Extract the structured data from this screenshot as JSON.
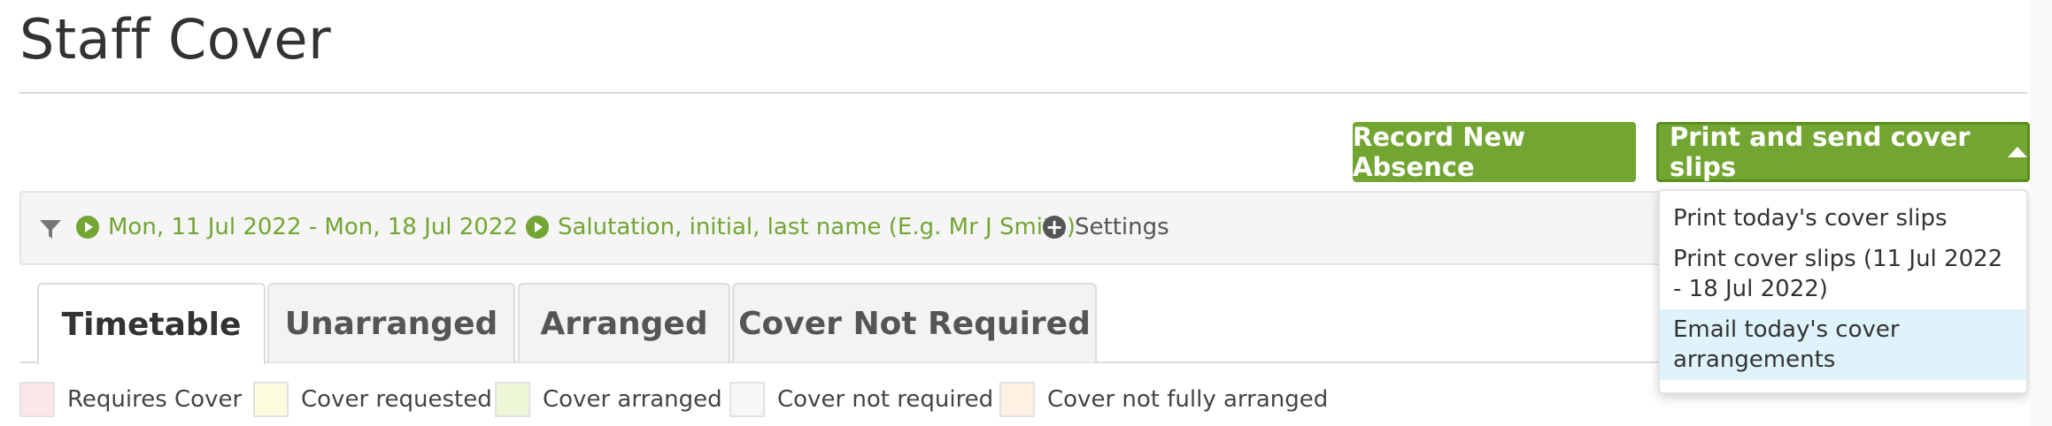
{
  "page": {
    "title": "Staff Cover"
  },
  "actions": {
    "record_label": "Record New Absence",
    "print_label": "Print and send cover slips",
    "accent_color": "#73a532"
  },
  "print_menu": {
    "items": [
      {
        "label": "Print today's cover slips"
      },
      {
        "label": "Print cover slips (11 Jul 2022 - 18 Jul 2022)"
      },
      {
        "label": "Email today's cover arrangements",
        "highlighted": true
      }
    ]
  },
  "filters": {
    "icon": "filter-icon",
    "date_range": "Mon, 11 Jul 2022 - Mon, 18 Jul 2022",
    "name_format": "Salutation, initial, last name (E.g. Mr J Smith)",
    "settings_label": "Settings"
  },
  "tabs": [
    {
      "label": "Timetable",
      "active": true
    },
    {
      "label": "Unarranged"
    },
    {
      "label": "Arranged"
    },
    {
      "label": "Cover Not Required"
    }
  ],
  "legend": [
    {
      "label": "Requires Cover",
      "color": "#fde6e8"
    },
    {
      "label": "Cover requested",
      "color": "#fdfbdd"
    },
    {
      "label": "Cover arranged",
      "color": "#eef6d8"
    },
    {
      "label": "Cover not required",
      "color": "#f7f7f7"
    },
    {
      "label": "Cover not fully arranged",
      "color": "#fdf1e3"
    }
  ]
}
